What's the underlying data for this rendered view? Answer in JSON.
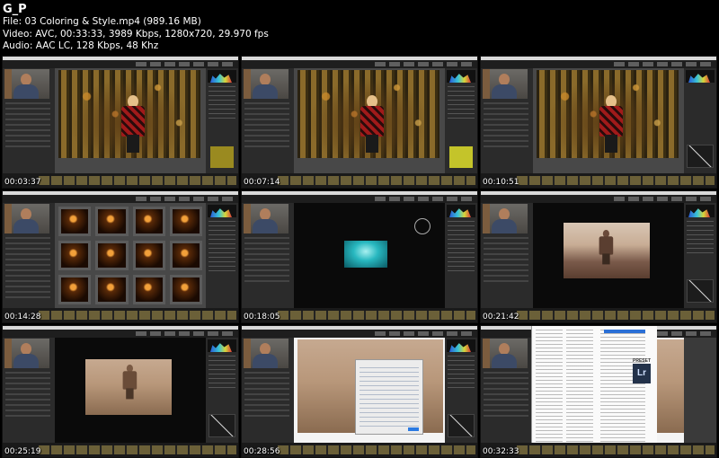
{
  "header": {
    "title": "G_P",
    "file_line": "File: 03   Coloring & Style.mp4 (989.16 MB)",
    "video_line": "Video: AVC, 00:33:33, 3989 Kbps, 1280x720, 29.970 fps",
    "audio_line": "Audio: AAC LC, 128 Kbps, 48 Khz"
  },
  "thumbnails": [
    {
      "timestamp": "00:03:37",
      "scene": "forest-portrait"
    },
    {
      "timestamp": "00:07:14",
      "scene": "forest-portrait"
    },
    {
      "timestamp": "00:10:51",
      "scene": "forest-portrait"
    },
    {
      "timestamp": "00:14:28",
      "scene": "library-grid"
    },
    {
      "timestamp": "00:18:05",
      "scene": "teal-preview"
    },
    {
      "timestamp": "00:21:42",
      "scene": "sepia-beach"
    },
    {
      "timestamp": "00:25:19",
      "scene": "sepia-beach"
    },
    {
      "timestamp": "00:28:56",
      "scene": "export-dialog"
    },
    {
      "timestamp": "00:32:33",
      "scene": "finder-presets"
    }
  ],
  "overlay_text": {
    "presets_label": "PRESET",
    "lr_icon": "Lr"
  },
  "colors": {
    "background": "#000000",
    "lightroom_panel": "#2b2b2b",
    "lightroom_center": "#484848"
  }
}
